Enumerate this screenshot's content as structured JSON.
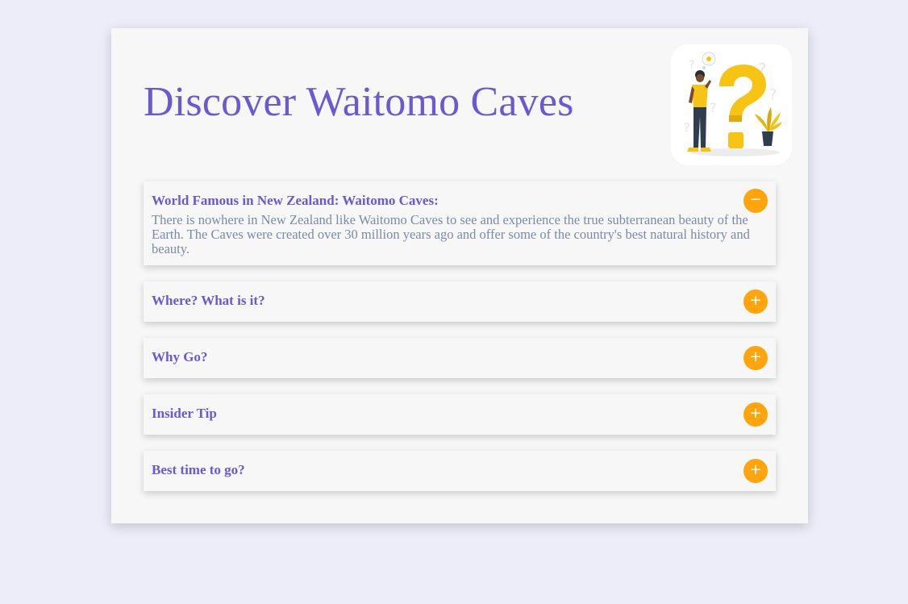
{
  "page": {
    "title": "Discover Waitomo Caves"
  },
  "faq": {
    "items": [
      {
        "question": "World Famous in New Zealand: Waitomo Caves:",
        "answer": "There is nowhere in New Zealand like Waitomo Caves to see and experience the true subterranean beauty of the Earth. The Caves were created over 30 million years ago and offer some of the country's best natural history and beauty.",
        "toggle": "−",
        "expanded": true
      },
      {
        "question": "Where? What is it?",
        "toggle": "+",
        "expanded": false
      },
      {
        "question": "Why Go?",
        "toggle": "+",
        "expanded": false
      },
      {
        "question": "Insider Tip",
        "toggle": "+",
        "expanded": false
      },
      {
        "question": "Best time to go?",
        "toggle": "+",
        "expanded": false
      }
    ]
  },
  "illustration": {
    "icon": "question-person-illustration-icon"
  },
  "colors": {
    "background": "#ecedf8",
    "card": "#f7f7f7",
    "accent": "#6a59d1",
    "toggle": "#fea40c",
    "answer_text": "#7a8aa8"
  }
}
